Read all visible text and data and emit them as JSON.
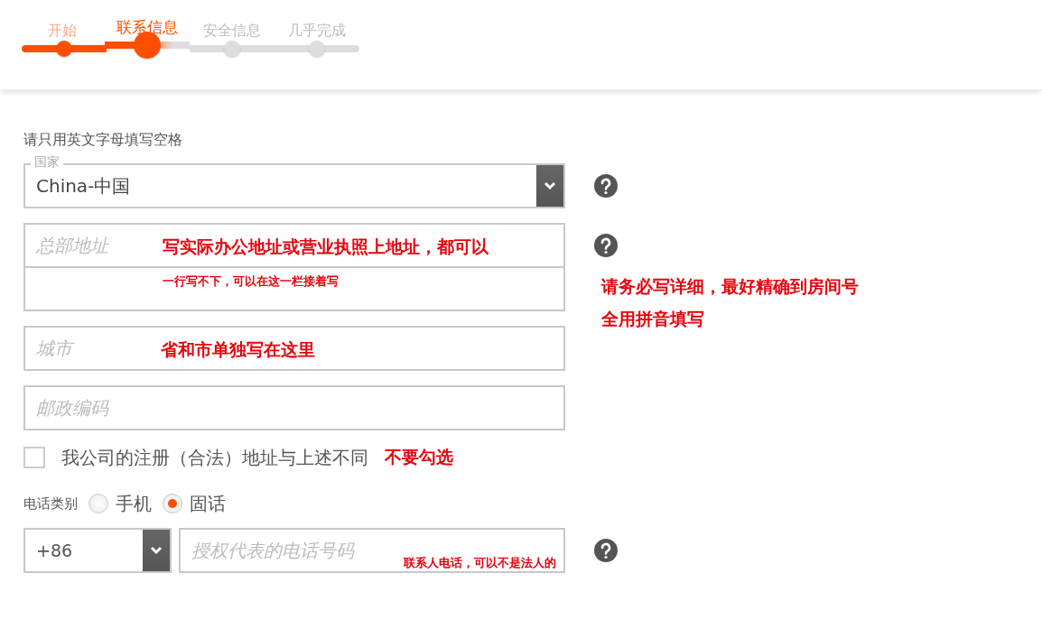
{
  "steps": [
    {
      "label": "开始",
      "completed": true,
      "selected": false
    },
    {
      "label": "联系信息",
      "completed": false,
      "selected": true
    },
    {
      "label": "安全信息",
      "completed": false,
      "selected": false
    },
    {
      "label": "几乎完成",
      "completed": false,
      "selected": false
    }
  ],
  "form": {
    "hint": "请只用英文字母填写空格",
    "country": {
      "legend": "国家",
      "value": "China-中国"
    },
    "address": {
      "placeholder": "总部地址",
      "note": "写实际办公地址或营业执照上地址，都可以",
      "line2_note": "一行写不下，可以在这一栏接着写",
      "side_note": [
        "请务必写详细，最好精确到房间号",
        "全用拼音填写"
      ]
    },
    "city": {
      "placeholder": "城市",
      "note": "省和市单独写在这里"
    },
    "postcode": {
      "placeholder": "邮政编码"
    },
    "registered_address": {
      "label": "我公司的注册（合法）地址与上述不同",
      "checked": false,
      "note": "不要勾选"
    },
    "phone_type": {
      "label": "电话类别",
      "options": [
        {
          "label": "手机",
          "selected": false
        },
        {
          "label": "固话",
          "selected": true
        }
      ]
    },
    "phone": {
      "code": "+86",
      "placeholder": "授权代表的电话号码",
      "note": "联系人电话，可以不是法人的"
    }
  }
}
